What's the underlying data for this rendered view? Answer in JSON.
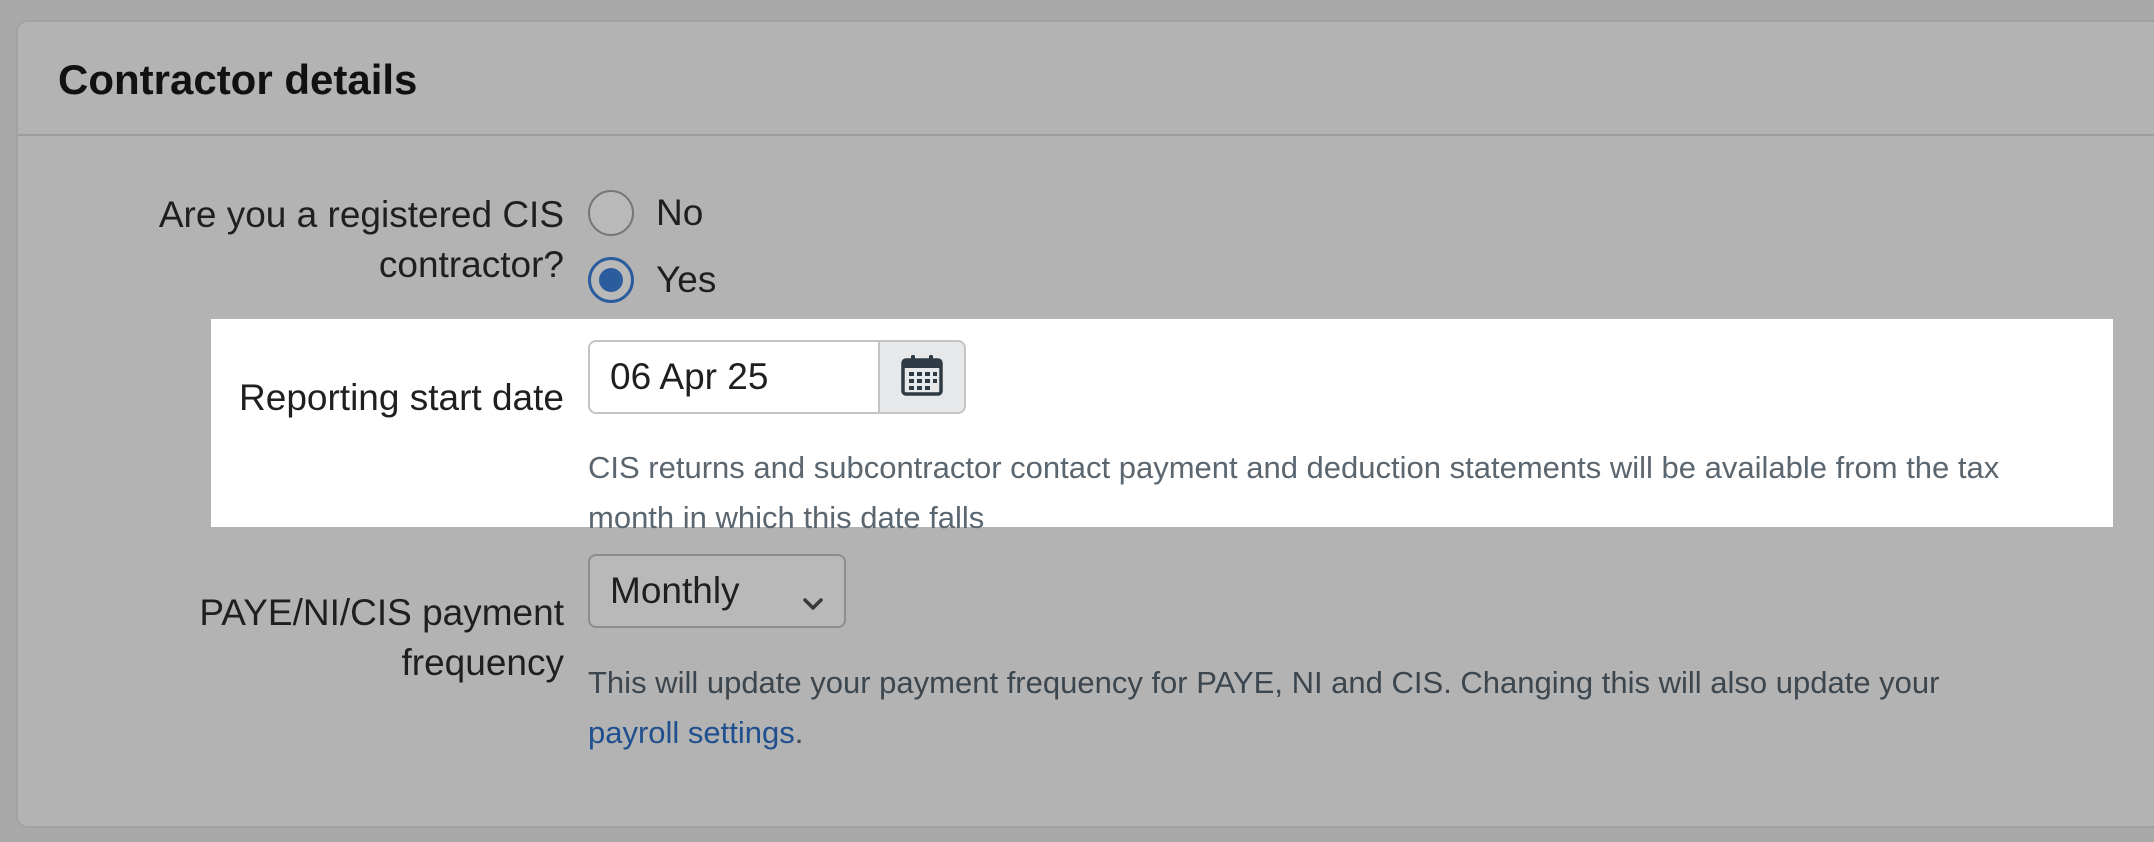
{
  "card": {
    "title": "Contractor details"
  },
  "cis_question": {
    "label_line1": "Are you a registered CIS",
    "label_line2": "contractor?",
    "options": [
      {
        "label": "No",
        "selected": false
      },
      {
        "label": "Yes",
        "selected": true
      }
    ]
  },
  "reporting_start": {
    "label": "Reporting start date",
    "value": "06 Apr 25",
    "calendar_icon": "calendar-icon",
    "help_line1": "CIS returns and subcontractor contact payment and deduction statements will be available from the tax",
    "help_line2": "month in which this date falls"
  },
  "payment_frequency": {
    "label_line1": "PAYE/NI/CIS payment",
    "label_line2": "frequency",
    "selected": "Monthly",
    "chevron_icon": "chevron-down-icon",
    "help_line1": "This will update your payment frequency for PAYE, NI and CIS. Changing this will also update your",
    "help_link": "payroll settings",
    "help_suffix": "."
  },
  "colors": {
    "overlay_bg": "#b3b3b3",
    "highlight_bg": "#ffffff",
    "accent": "#2b5c9e",
    "link": "#1f4f8f"
  }
}
